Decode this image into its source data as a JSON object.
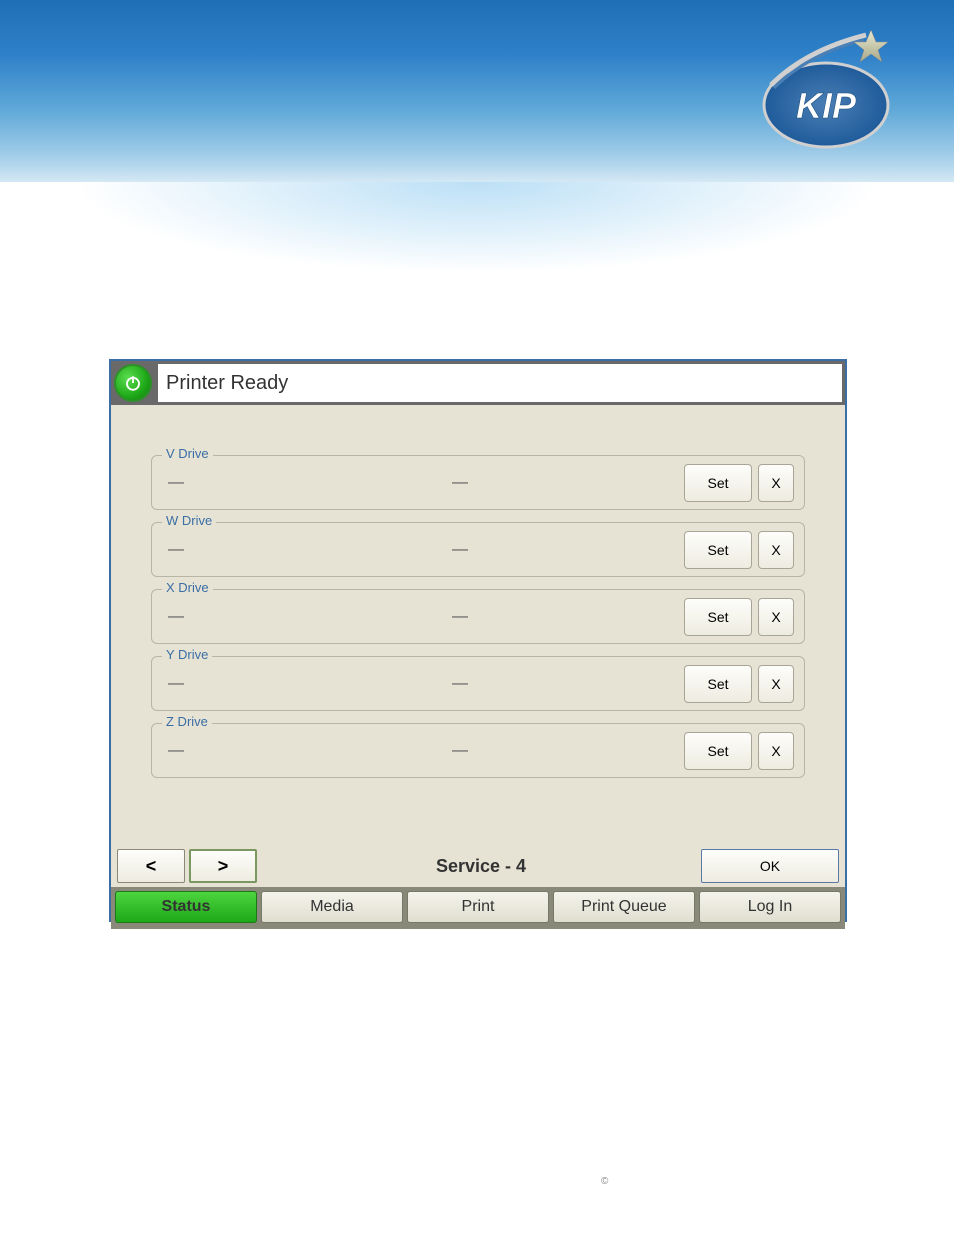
{
  "logo": {
    "text": "KIP"
  },
  "titleBar": {
    "status": "Printer Ready"
  },
  "drives": [
    {
      "label": "V Drive",
      "val1": "—",
      "val2": "—",
      "set": "Set",
      "x": "X"
    },
    {
      "label": "W Drive",
      "val1": "—",
      "val2": "—",
      "set": "Set",
      "x": "X"
    },
    {
      "label": "X Drive",
      "val1": "—",
      "val2": "—",
      "set": "Set",
      "x": "X"
    },
    {
      "label": "Y Drive",
      "val1": "—",
      "val2": "—",
      "set": "Set",
      "x": "X"
    },
    {
      "label": "Z Drive",
      "val1": "—",
      "val2": "—",
      "set": "Set",
      "x": "X"
    }
  ],
  "nav": {
    "prev": "<",
    "next": ">",
    "title": "Service - 4",
    "ok": "OK"
  },
  "tabs": {
    "status": "Status",
    "media": "Media",
    "print": "Print",
    "printQueue": "Print Queue",
    "login": "Log In"
  },
  "copyright": "©"
}
